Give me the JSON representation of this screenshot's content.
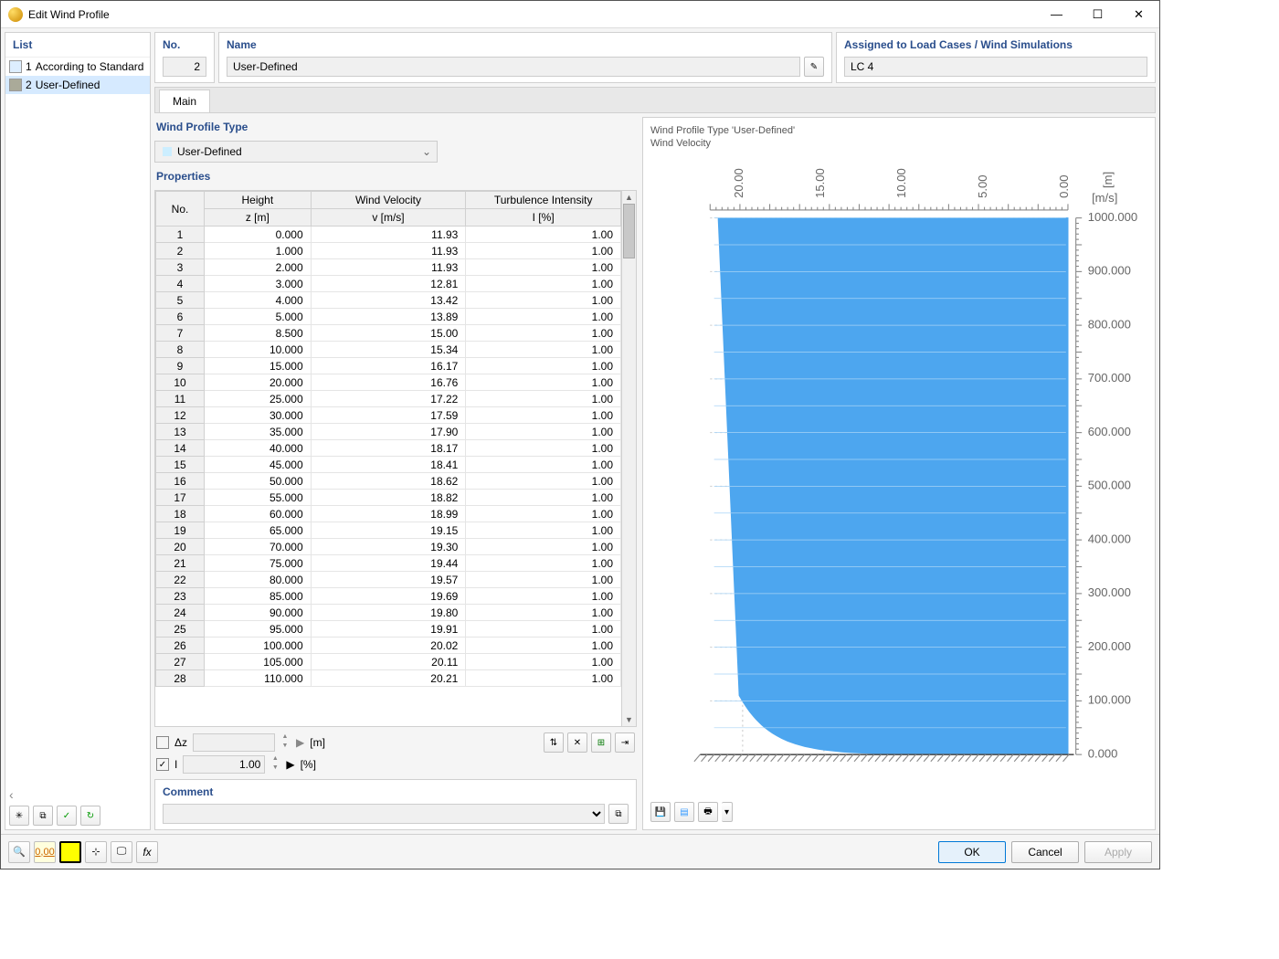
{
  "window": {
    "title": "Edit Wind Profile"
  },
  "list": {
    "header": "List",
    "items": [
      {
        "num": "1",
        "label": "According to Standard"
      },
      {
        "num": "2",
        "label": "User-Defined",
        "selected": true
      }
    ]
  },
  "fields": {
    "no_label": "No.",
    "no_value": "2",
    "name_label": "Name",
    "name_value": "User-Defined",
    "assign_label": "Assigned to Load Cases / Wind Simulations",
    "assign_value": "LC 4"
  },
  "tab": "Main",
  "wptype": {
    "label": "Wind Profile Type",
    "value": "User-Defined"
  },
  "props": {
    "label": "Properties",
    "cols": {
      "no": "No.",
      "h1": "Height",
      "h2": "z [m]",
      "v1": "Wind Velocity",
      "v2": "v [m/s]",
      "t1": "Turbulence Intensity",
      "t2": "I [%]"
    },
    "rows": [
      {
        "n": "1",
        "h": "0.000",
        "v": "11.93",
        "t": "1.00"
      },
      {
        "n": "2",
        "h": "1.000",
        "v": "11.93",
        "t": "1.00"
      },
      {
        "n": "3",
        "h": "2.000",
        "v": "11.93",
        "t": "1.00"
      },
      {
        "n": "4",
        "h": "3.000",
        "v": "12.81",
        "t": "1.00"
      },
      {
        "n": "5",
        "h": "4.000",
        "v": "13.42",
        "t": "1.00"
      },
      {
        "n": "6",
        "h": "5.000",
        "v": "13.89",
        "t": "1.00"
      },
      {
        "n": "7",
        "h": "8.500",
        "v": "15.00",
        "t": "1.00"
      },
      {
        "n": "8",
        "h": "10.000",
        "v": "15.34",
        "t": "1.00"
      },
      {
        "n": "9",
        "h": "15.000",
        "v": "16.17",
        "t": "1.00"
      },
      {
        "n": "10",
        "h": "20.000",
        "v": "16.76",
        "t": "1.00"
      },
      {
        "n": "11",
        "h": "25.000",
        "v": "17.22",
        "t": "1.00"
      },
      {
        "n": "12",
        "h": "30.000",
        "v": "17.59",
        "t": "1.00"
      },
      {
        "n": "13",
        "h": "35.000",
        "v": "17.90",
        "t": "1.00"
      },
      {
        "n": "14",
        "h": "40.000",
        "v": "18.17",
        "t": "1.00"
      },
      {
        "n": "15",
        "h": "45.000",
        "v": "18.41",
        "t": "1.00"
      },
      {
        "n": "16",
        "h": "50.000",
        "v": "18.62",
        "t": "1.00"
      },
      {
        "n": "17",
        "h": "55.000",
        "v": "18.82",
        "t": "1.00"
      },
      {
        "n": "18",
        "h": "60.000",
        "v": "18.99",
        "t": "1.00"
      },
      {
        "n": "19",
        "h": "65.000",
        "v": "19.15",
        "t": "1.00"
      },
      {
        "n": "20",
        "h": "70.000",
        "v": "19.30",
        "t": "1.00"
      },
      {
        "n": "21",
        "h": "75.000",
        "v": "19.44",
        "t": "1.00"
      },
      {
        "n": "22",
        "h": "80.000",
        "v": "19.57",
        "t": "1.00"
      },
      {
        "n": "23",
        "h": "85.000",
        "v": "19.69",
        "t": "1.00"
      },
      {
        "n": "24",
        "h": "90.000",
        "v": "19.80",
        "t": "1.00"
      },
      {
        "n": "25",
        "h": "95.000",
        "v": "19.91",
        "t": "1.00"
      },
      {
        "n": "26",
        "h": "100.000",
        "v": "20.02",
        "t": "1.00"
      },
      {
        "n": "27",
        "h": "105.000",
        "v": "20.11",
        "t": "1.00"
      },
      {
        "n": "28",
        "h": "110.000",
        "v": "20.21",
        "t": "1.00"
      }
    ]
  },
  "below": {
    "dz_label": "Δz",
    "dz_unit": "[m]",
    "dz_checked": false,
    "i_label": "I",
    "i_value": "1.00",
    "i_unit": "[%]",
    "i_checked": true
  },
  "comment": {
    "label": "Comment"
  },
  "chart": {
    "title": "Wind Profile Type 'User-Defined'",
    "subtitle": "Wind Velocity",
    "x_unit": "[m/s]",
    "y_unit": "[m]",
    "x_ticks": [
      "20.00",
      "15.00",
      "10.00",
      "5.00",
      "0.00"
    ],
    "y_ticks": [
      "1000.000",
      "900.000",
      "800.000",
      "700.000",
      "600.000",
      "500.000",
      "400.000",
      "300.000",
      "200.000",
      "100.000",
      "0.000"
    ]
  },
  "chart_data": {
    "type": "area",
    "title": "Wind Profile Type 'User-Defined' — Wind Velocity",
    "xlabel": "v [m/s]",
    "ylabel": "z [m]",
    "xlim": [
      0,
      22
    ],
    "ylim": [
      0,
      1000
    ],
    "x_reversed": true,
    "series": [
      {
        "name": "Wind Velocity",
        "x": [
          11.93,
          11.93,
          11.93,
          12.81,
          13.42,
          13.89,
          15.0,
          15.34,
          16.17,
          16.76,
          17.22,
          17.59,
          17.9,
          18.17,
          18.41,
          18.62,
          18.82,
          18.99,
          19.15,
          19.3,
          19.44,
          19.57,
          19.69,
          19.8,
          19.91,
          20.02,
          20.11,
          20.21,
          21.5
        ],
        "y": [
          0,
          1,
          2,
          3,
          4,
          5,
          8.5,
          10,
          15,
          20,
          25,
          30,
          35,
          40,
          45,
          50,
          55,
          60,
          65,
          70,
          75,
          80,
          85,
          90,
          95,
          100,
          105,
          110,
          1000
        ]
      }
    ]
  },
  "buttons": {
    "ok": "OK",
    "cancel": "Cancel",
    "apply": "Apply"
  }
}
